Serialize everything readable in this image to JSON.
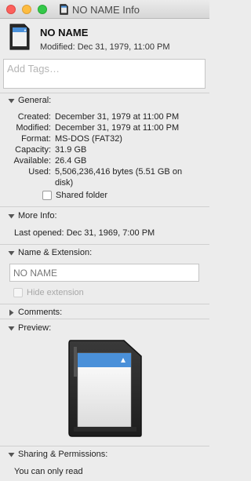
{
  "window": {
    "title": "NO NAME Info"
  },
  "header": {
    "name": "NO NAME",
    "modified": "Modified: Dec 31, 1979, 11:00 PM"
  },
  "tags": {
    "placeholder": "Add Tags…"
  },
  "general": {
    "title": "General:",
    "rows": [
      {
        "label": "Created:",
        "value": "December 31, 1979 at 11:00 PM"
      },
      {
        "label": "Modified:",
        "value": "December 31, 1979 at 11:00 PM"
      },
      {
        "label": "Format:",
        "value": "MS-DOS (FAT32)"
      },
      {
        "label": "Capacity:",
        "value": "31.9 GB"
      },
      {
        "label": "Available:",
        "value": "26.4 GB"
      },
      {
        "label": "Used:",
        "value": "5,506,236,416 bytes (5.51 GB on",
        "continuation": "disk)"
      }
    ],
    "shared_folder_label": "Shared folder"
  },
  "more_info": {
    "title": "More Info:",
    "last_opened_label": "Last opened:",
    "last_opened_value": "Dec 31, 1969, 7:00 PM"
  },
  "name_extension": {
    "title": "Name & Extension:",
    "name_value": "NO NAME",
    "hide_extension_label": "Hide extension"
  },
  "comments": {
    "title": "Comments:"
  },
  "preview": {
    "title": "Preview:"
  },
  "sharing": {
    "title": "Sharing & Permissions:",
    "status": "You can only read"
  },
  "colors": {
    "close": "#fc605c",
    "minimize": "#fdbc40",
    "maximize": "#34c84a",
    "sd_label_blue": "#4a90d9"
  },
  "icons": {
    "title": "sd-card-icon",
    "header": "sd-card-icon",
    "preview": "sd-card-preview"
  }
}
